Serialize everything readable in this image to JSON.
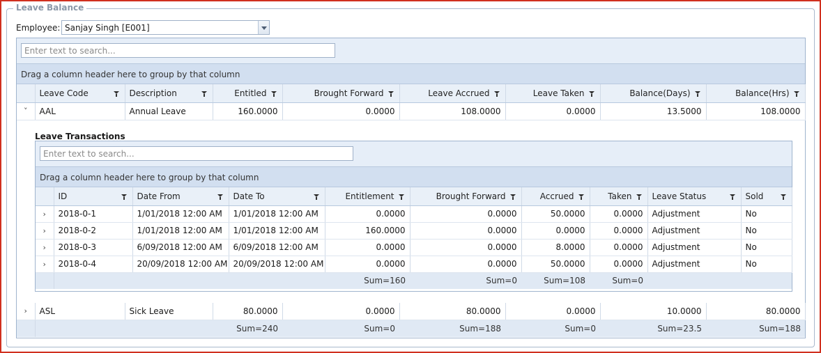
{
  "panel": {
    "legend": "Leave Balance"
  },
  "employee": {
    "label": "Employee:",
    "value": "Sanjay Singh [E001]"
  },
  "outer_grid": {
    "search_placeholder": "Enter text to search...",
    "group_hint": "Drag a column header here to group by that column",
    "columns": [
      "Leave Code",
      "Description",
      "Entitled",
      "Brought Forward",
      "Leave Accrued",
      "Leave Taken",
      "Balance(Days)",
      "Balance(Hrs)"
    ],
    "rows": [
      {
        "expander": "˅",
        "cells": [
          "AAL",
          "Annual Leave",
          "160.0000",
          "0.0000",
          "108.0000",
          "0.0000",
          "13.5000",
          "108.0000"
        ]
      },
      {
        "expander": "›",
        "cells": [
          "ASL",
          "Sick Leave",
          "80.0000",
          "0.0000",
          "80.0000",
          "0.0000",
          "10.0000",
          "80.0000"
        ]
      }
    ],
    "footer": [
      "",
      "",
      "Sum=240",
      "Sum=0",
      "Sum=188",
      "Sum=0",
      "Sum=23.5",
      "Sum=188"
    ]
  },
  "detail_grid": {
    "title": "Leave Transactions",
    "search_placeholder": "Enter text to search...",
    "group_hint": "Drag a column header here to group by that column",
    "columns": [
      "ID",
      "Date From",
      "Date To",
      "Entitlement",
      "Brought Forward",
      "Accrued",
      "Taken",
      "Leave Status",
      "Sold"
    ],
    "rows": [
      {
        "expander": "›",
        "cells": [
          "2018-0-1",
          "1/01/2018 12:00 AM",
          "1/01/2018 12:00 AM",
          "0.0000",
          "0.0000",
          "50.0000",
          "0.0000",
          "Adjustment",
          "No"
        ]
      },
      {
        "expander": "›",
        "cells": [
          "2018-0-2",
          "1/01/2018 12:00 AM",
          "1/01/2018 12:00 AM",
          "160.0000",
          "0.0000",
          "0.0000",
          "0.0000",
          "Adjustment",
          "No"
        ]
      },
      {
        "expander": "›",
        "cells": [
          "2018-0-3",
          "6/09/2018 12:00 AM",
          "6/09/2018 12:00 AM",
          "0.0000",
          "0.0000",
          "8.0000",
          "0.0000",
          "Adjustment",
          "No"
        ]
      },
      {
        "expander": "›",
        "cells": [
          "2018-0-4",
          "20/09/2018 12:00 AM",
          "20/09/2018 12:00 AM",
          "0.0000",
          "0.0000",
          "50.0000",
          "0.0000",
          "Adjustment",
          "No"
        ]
      }
    ],
    "footer": [
      "",
      "",
      "",
      "Sum=160",
      "Sum=0",
      "Sum=108",
      "Sum=0",
      "",
      ""
    ]
  },
  "icons": {
    "filter": "filter-icon",
    "dropdown": "chevron-down-icon",
    "expand": "chevron-right-icon",
    "collapse": "chevron-down-icon"
  },
  "colors": {
    "frame_border": "#d0301f",
    "header_bg": "#e9f0f8",
    "group_panel_bg": "#d2dff0",
    "footer_bg": "#e0e9f4"
  }
}
